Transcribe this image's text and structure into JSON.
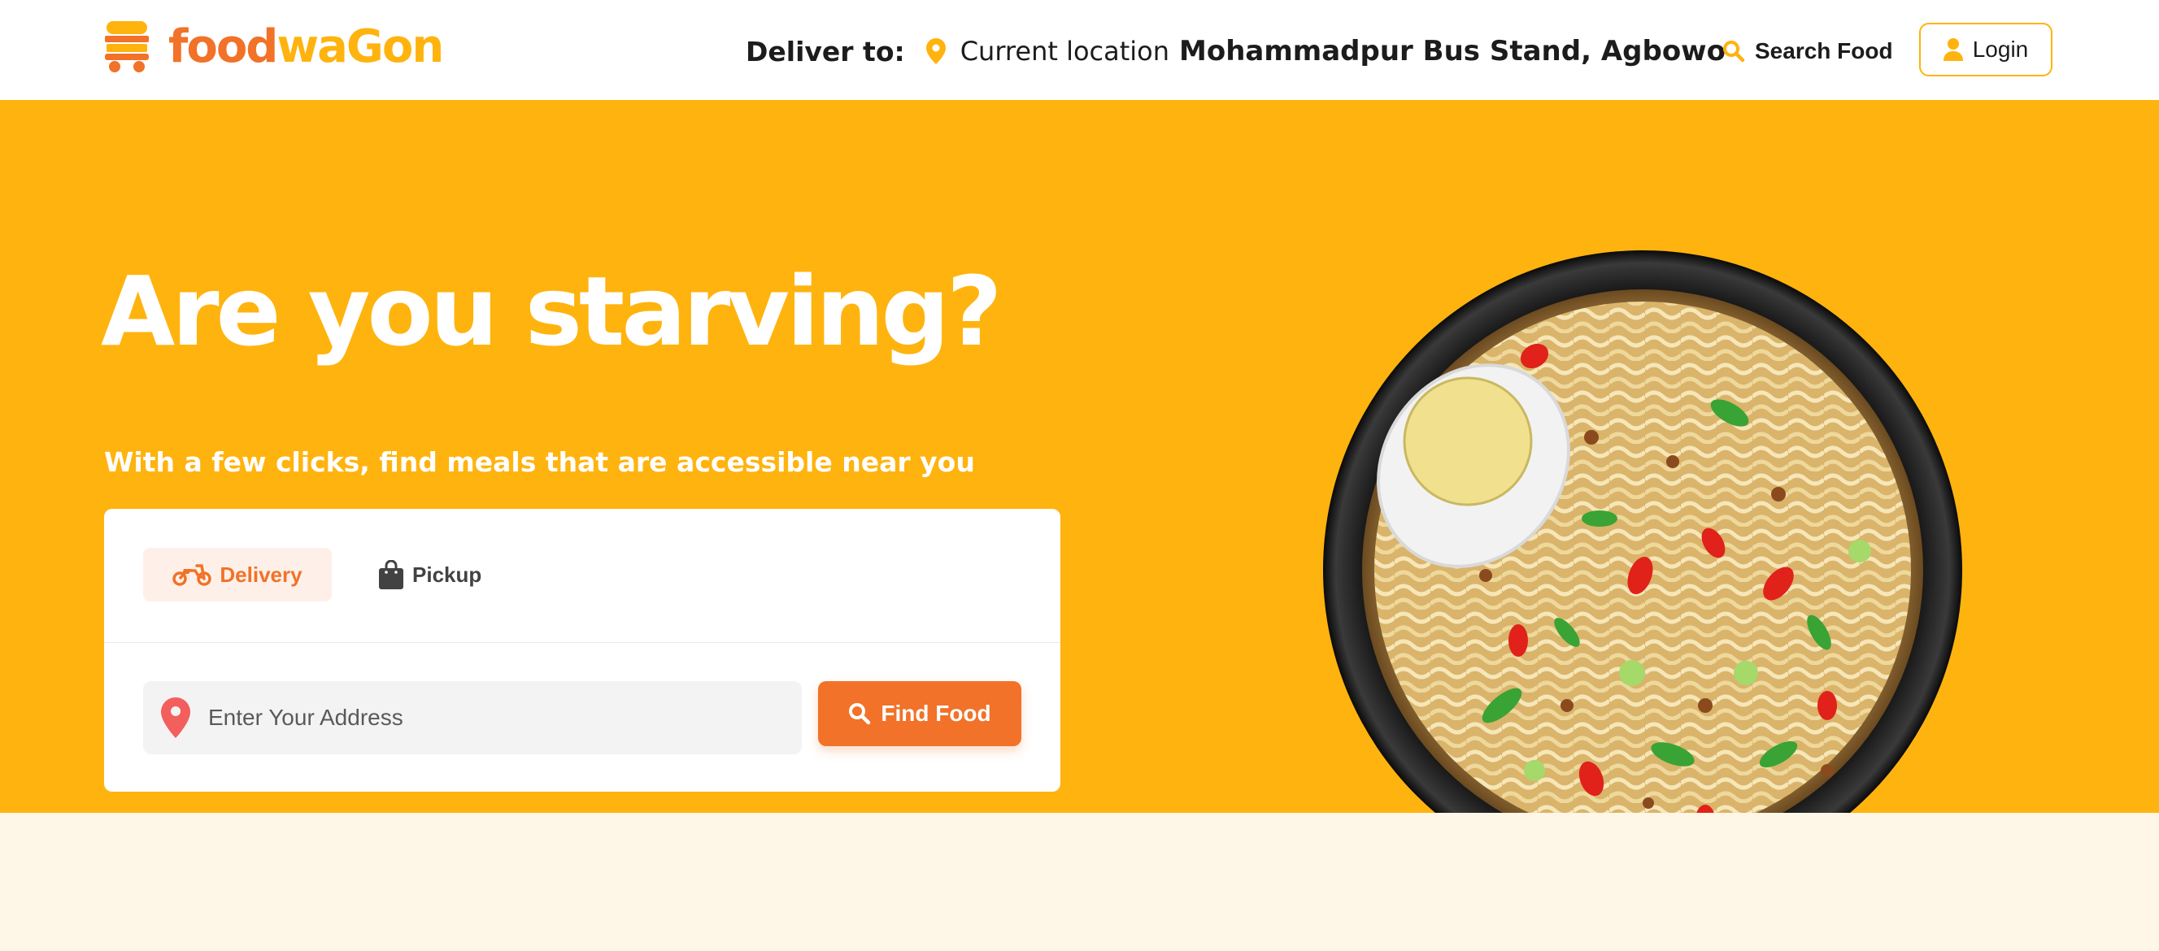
{
  "brand": {
    "part1": "food",
    "part2": "waGon",
    "primary_color": "#f17228",
    "secondary_color": "#ffb30e"
  },
  "header": {
    "deliver_label": "Deliver to:",
    "current_location_label": "Current location",
    "address": "Mohammadpur Bus Stand, Agbowo",
    "search_label": "Search Food",
    "login_label": "Login"
  },
  "hero": {
    "title": "Are you starving?",
    "subtitle": "With a few clicks, find meals that are accessible near you",
    "background_color": "#ffb30e"
  },
  "search_card": {
    "tabs": [
      {
        "label": "Delivery",
        "icon": "motorcycle-icon",
        "active": true
      },
      {
        "label": "Pickup",
        "icon": "shopping-bag-icon",
        "active": false
      }
    ],
    "address_placeholder": "Enter Your Address",
    "address_value": "",
    "find_button_label": "Find Food"
  },
  "icons": [
    "burger-truck-logo-icon",
    "location-pin-icon",
    "search-icon",
    "user-icon",
    "motorcycle-icon",
    "shopping-bag-icon",
    "map-pin-icon"
  ]
}
